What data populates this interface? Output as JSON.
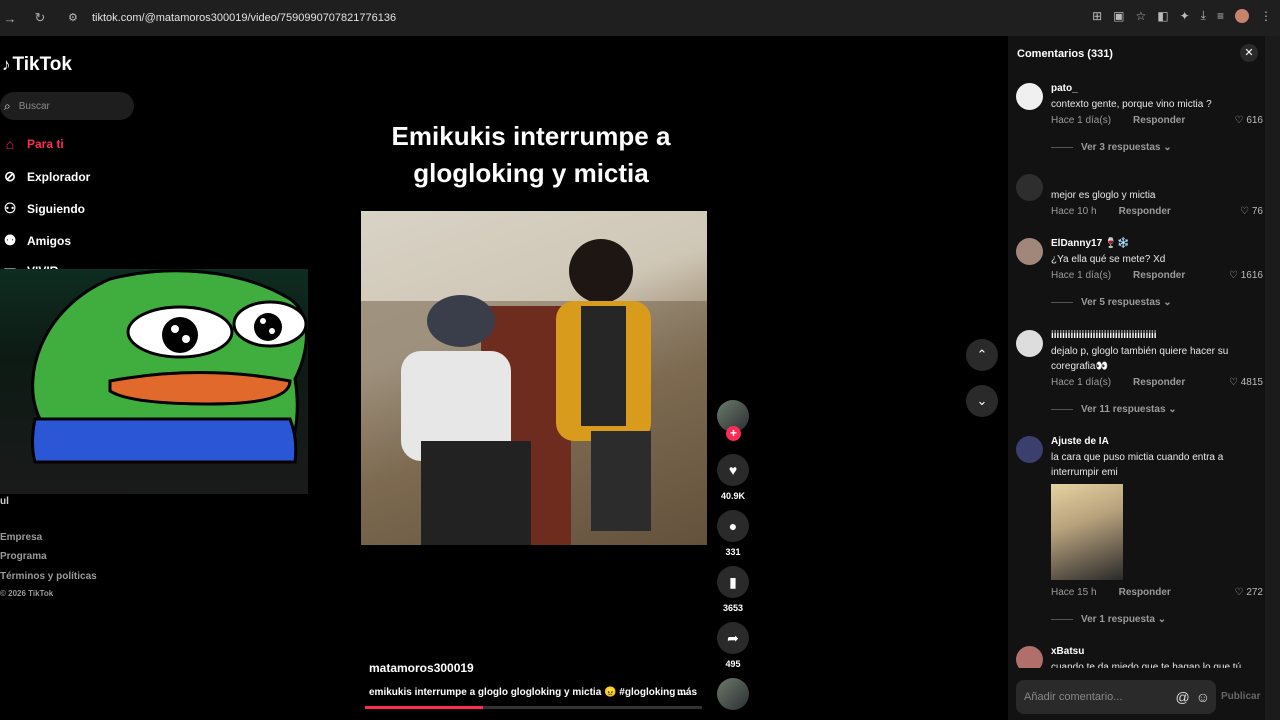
{
  "browser": {
    "url": "tiktok.com/@matamoros300019/video/7590990707821776136",
    "nav_icons": [
      "back-icon",
      "forward-icon",
      "reload-icon"
    ]
  },
  "sidebar": {
    "logo": "TikTok",
    "search_placeholder": "Buscar",
    "items": [
      {
        "label": "Para ti",
        "icon": "home-icon",
        "active": true
      },
      {
        "label": "Explorador",
        "icon": "compass-icon"
      },
      {
        "label": "Siguiendo",
        "icon": "following-icon"
      },
      {
        "label": "Amigos",
        "icon": "friends-icon"
      },
      {
        "label": "VIVIR",
        "icon": "live-icon"
      }
    ],
    "partial_text": "ul",
    "footer": [
      "Empresa",
      "Programa",
      "Términos y políticas",
      "© 2026 TikTok"
    ]
  },
  "video": {
    "title_line1": "Emikukis interrumpe a",
    "title_line2": "glogloking y mictia",
    "author": "matamoros300019",
    "caption": "emikukis interrumpe a gloglo glogloking y mictia 😠 #glogloking ...",
    "more": "más",
    "progress": 0.35
  },
  "actions": {
    "likes": "40.9K",
    "comments": "331",
    "saves": "3653",
    "shares": "495"
  },
  "comments_panel": {
    "title": "Comentarios (331)",
    "reply_label": "Responder",
    "items": [
      {
        "user": "pato_",
        "text": "contexto gente, porque vino mictia ?",
        "time": "Hace 1 día(s)",
        "likes": "616",
        "replies": "Ver 3 respuestas"
      },
      {
        "user": "",
        "text": "mejor es gloglo y mictia",
        "time": "Hace 10 h",
        "likes": "76",
        "replies": ""
      },
      {
        "user": "ElDanny17 🍷❄️",
        "text": "¿Ya ella qué se mete? Xd",
        "time": "Hace 1 día(s)",
        "likes": "1616",
        "replies": "Ver 5 respuestas"
      },
      {
        "user": "iiiiiiiiiiiiiiiiiiiiiiiiiiiiiiiiiiiiii",
        "text": "dejalo p, gloglo también quiere hacer su coregrafia👀",
        "time": "Hace 1 día(s)",
        "likes": "4815",
        "replies": "Ver 11 respuestas"
      },
      {
        "user": "Ajuste de IA",
        "text": "la cara que puso mictia cuando entra a interrumpir emi",
        "time": "Hace 15 h",
        "likes": "272",
        "replies": "Ver 1 respuesta"
      },
      {
        "user": "xBatsu",
        "text": "cuando te da miedo que te hagan lo que tú",
        "time": "",
        "likes": "",
        "replies": ""
      }
    ],
    "input_placeholder": "Añadir comentario...",
    "publish": "Publicar"
  }
}
